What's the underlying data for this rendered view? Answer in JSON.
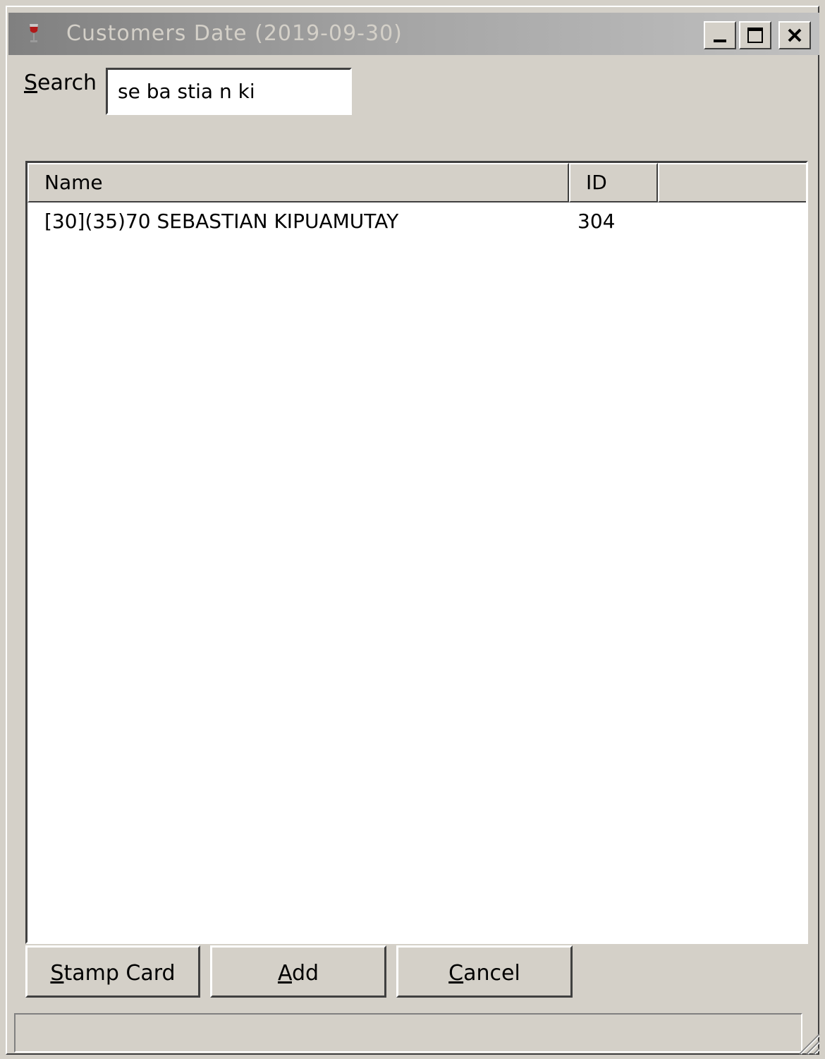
{
  "window": {
    "title": "Customers Date (2019-09-30)",
    "minimize_label": "_",
    "maximize_label": "□",
    "close_label": "X"
  },
  "search": {
    "label": "Search",
    "value": "se ba stia n ki"
  },
  "table": {
    "columns": [
      "Name",
      "ID"
    ],
    "rows": [
      {
        "name": "[30](35)70 SEBASTIAN KIPUAMUTAY",
        "id": "304"
      }
    ]
  },
  "buttons": {
    "stamp_card": "Stamp Card",
    "add": "Add",
    "cancel": "Cancel"
  },
  "statusbar": {
    "text": ""
  },
  "icons": {
    "app": "wine-glass-icon",
    "resize": "resize-grip-icon"
  }
}
